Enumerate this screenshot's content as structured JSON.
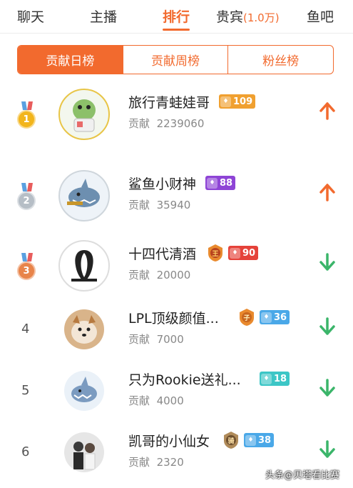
{
  "nav": {
    "tabs": [
      {
        "label": "聊天",
        "active": false
      },
      {
        "label": "主播",
        "active": false
      },
      {
        "label": "排行",
        "active": true
      },
      {
        "label": "贵宾",
        "sub": "(1.0万)",
        "active": false
      },
      {
        "label": "鱼吧",
        "active": false
      }
    ]
  },
  "segments": [
    "贡献日榜",
    "贡献周榜",
    "粉丝榜"
  ],
  "active_segment": 0,
  "colors": {
    "accent": "#f26a2e",
    "up": "#f26a2e",
    "down": "#3bb56a"
  },
  "ranking": [
    {
      "rank": "1",
      "name": "旅行青蛙娃哥",
      "contrib_label": "贡献",
      "contrib": "2239060",
      "level": "109",
      "level_color": "#f0a030",
      "trend": "up",
      "avatar": "frog-avatar"
    },
    {
      "rank": "2",
      "name": "鲨鱼小财神",
      "contrib_label": "贡献",
      "contrib": "35940",
      "level": "88",
      "level_color": "#8e44d6",
      "trend": "up",
      "avatar": "shark-avatar"
    },
    {
      "rank": "3",
      "name": "十四代清酒",
      "contrib_label": "贡献",
      "contrib": "20000",
      "level": "90",
      "level_color": "#e5423a",
      "noble": "王",
      "trend": "down",
      "avatar": "ig-logo-avatar"
    },
    {
      "rank": "4",
      "name": "LPL顶级颜值...",
      "contrib_label": "贡献",
      "contrib": "7000",
      "level": "36",
      "level_color": "#4aa8e8",
      "noble": "子",
      "trend": "down",
      "avatar": "dog-avatar"
    },
    {
      "rank": "5",
      "name": "只为Rookie送礼...",
      "contrib_label": "贡献",
      "contrib": "4000",
      "level": "18",
      "level_color": "#3cc6c6",
      "trend": "down",
      "avatar": "shark-cartoon-avatar"
    },
    {
      "rank": "6",
      "name": "凯哥的小仙女",
      "contrib_label": "贡献",
      "contrib": "2320",
      "level": "38",
      "level_color": "#4aa8e8",
      "noble": "骑",
      "trend": "down",
      "avatar": "couple-photo-avatar"
    }
  ],
  "watermark": "头条@贝塔看比赛"
}
